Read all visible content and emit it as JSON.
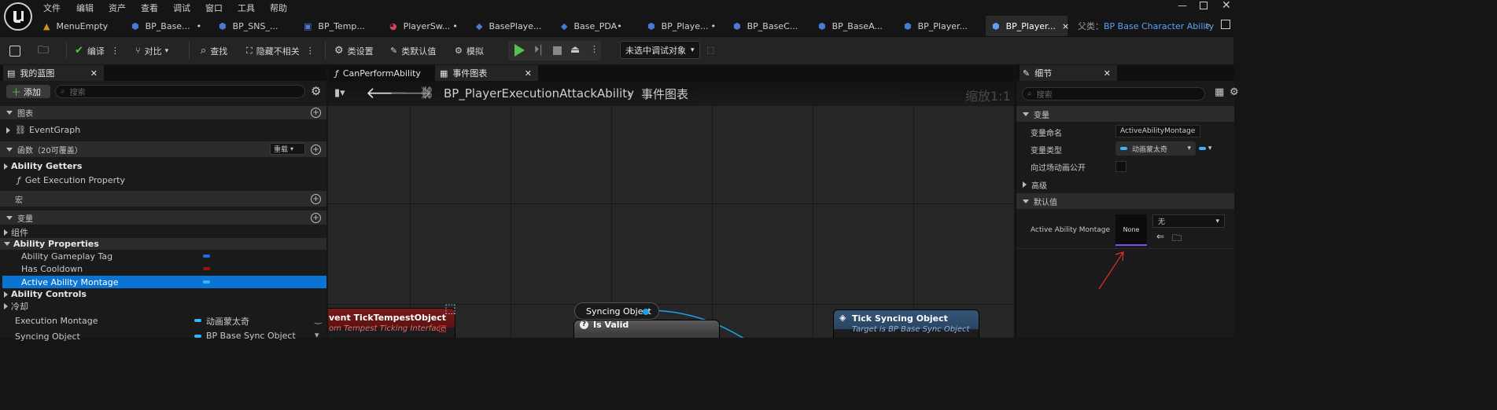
{
  "menu": [
    "文件",
    "编辑",
    "资产",
    "查看",
    "调试",
    "窗口",
    "工具",
    "帮助"
  ],
  "tabs": [
    {
      "label": "MenuEmpty",
      "color": "#d09020"
    },
    {
      "label": "BP_Base...",
      "color": "#4a7bd4",
      "modified": "•"
    },
    {
      "label": "BP_SNS_...",
      "color": "#4a7bd4"
    },
    {
      "label": "BP_Temp...",
      "color": "#4a7bd4"
    },
    {
      "label": "PlayerSw...",
      "color": "#d04060",
      "modified": "•"
    },
    {
      "label": "BasePlaye...",
      "color": "#4a7bd4"
    },
    {
      "label": "Base_PDA",
      "color": "#4a7bd4",
      "modified": "•"
    },
    {
      "label": "BP_Playe...",
      "color": "#4a7bd4",
      "modified": "•"
    },
    {
      "label": "BP_BaseC...",
      "color": "#4a7bd4"
    },
    {
      "label": "BP_BaseA...",
      "color": "#4a7bd4"
    },
    {
      "label": "BP_Player...",
      "color": "#4a7bd4"
    },
    {
      "label": "BP_Player...",
      "color": "#4a7bd4",
      "active": true,
      "close": "×"
    }
  ],
  "parent_class": {
    "label": "父类：",
    "value": "BP Base Character Ability"
  },
  "toolbar": {
    "compile": "编译",
    "diff": "对比",
    "find": "查找",
    "hide_unrelated": "隐藏不相关",
    "class_settings": "类设置",
    "class_defaults": "类默认值",
    "simulate": "模拟",
    "debug_target": "未选中调试对象"
  },
  "my_blueprint": {
    "tab": "我的蓝图",
    "add": "添加",
    "search_placeholder": "搜索",
    "graphs_header": "图表",
    "event_graph": "EventGraph",
    "functions_header": "函数（20可覆盖）",
    "override": "重载",
    "ability_getters": "Ability Getters",
    "get_exec_prop": "Get Execution Property",
    "macros_header": "宏",
    "variables_header": "变量",
    "components": "组件",
    "ability_properties": "Ability Properties",
    "vars": [
      {
        "name": "Ability Gameplay Tag",
        "color": "#1e6fd9"
      },
      {
        "name": "Has Cooldown",
        "color": "#a01010"
      },
      {
        "name": "Active Ability Montage",
        "color": "#2aa0f0",
        "selected": true
      }
    ],
    "ability_controls": "Ability Controls",
    "cooldown": "冷却",
    "exec_montage": {
      "name": "Execution Montage",
      "type": "动画蒙太奇"
    },
    "syncing_object": {
      "name": "Syncing Object",
      "type": "BP Base Sync Object"
    }
  },
  "graph": {
    "tab_can_perform": "CanPerformAbility",
    "tab_event_graph": "事件图表",
    "breadcrumb_bp": "BP_PlayerExecutionAttackAbility",
    "breadcrumb_graph": "事件图表",
    "zoom": "缩放1:1",
    "node_event_title": "vent TickTempestObject",
    "node_event_sub": "om Tempest Ticking Interface",
    "node_sync": "Syncing Object",
    "node_isvalid": "Is Valid",
    "node_tick_title": "Tick Syncing Object",
    "node_tick_sub": "Target is BP Base Sync Object"
  },
  "details": {
    "tab": "细节",
    "search_placeholder": "搜索",
    "variable_header": "变量",
    "var_name_label": "变量命名",
    "var_name_value": "ActiveAbilityMontage",
    "var_type_label": "变量类型",
    "var_type_value": "动画蒙太奇",
    "expose_label": "向过场动画公开",
    "advanced": "高级",
    "default_header": "默认值",
    "default_label": "Active Ability Montage",
    "thumb": "None",
    "asset_value": "无"
  },
  "colors": {
    "accent": "#1578d4",
    "play": "#57c24a",
    "selected_row": "#0a74d4",
    "annotation_arrow": "#e0302a"
  }
}
